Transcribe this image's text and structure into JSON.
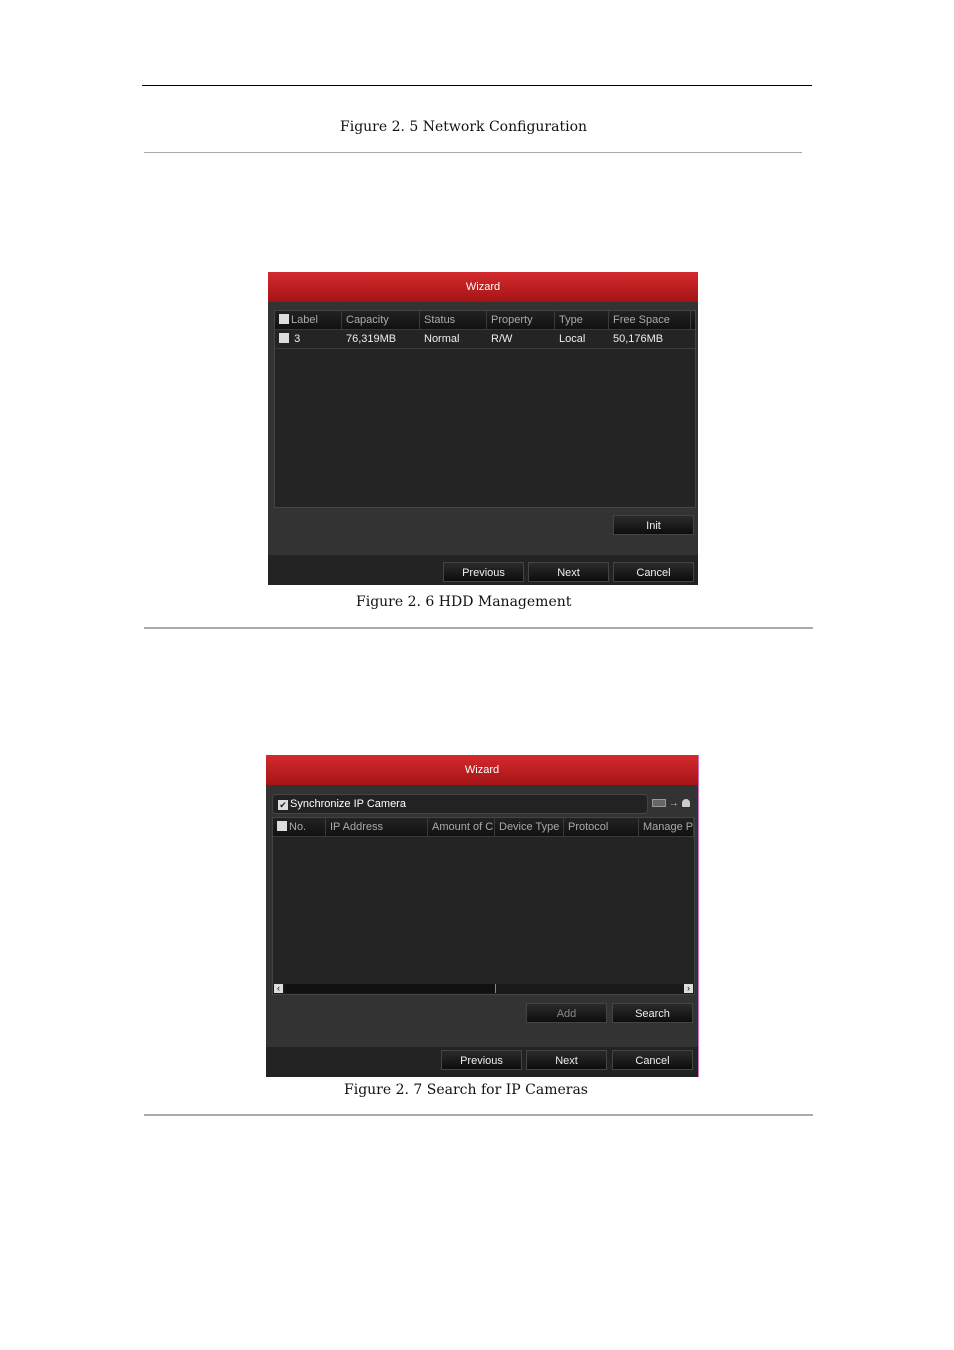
{
  "captions": {
    "fig25": "Figure 2. 5 Network Configuration",
    "fig26": "Figure 2. 6 HDD Management",
    "fig27": "Figure 2. 7 Search for IP Cameras"
  },
  "hdd_wizard": {
    "title": "Wizard",
    "columns": [
      "Label",
      "Capacity",
      "Status",
      "Property",
      "Type",
      "Free Space"
    ],
    "rows": [
      {
        "label": "3",
        "capacity": "76,319MB",
        "status": "Normal",
        "property": "R/W",
        "type": "Local",
        "free_space": "50,176MB"
      }
    ],
    "init_label": "Init",
    "previous_label": "Previous",
    "next_label": "Next",
    "cancel_label": "Cancel"
  },
  "ipcam_wizard": {
    "title": "Wizard",
    "sync_label": "Synchronize IP Camera",
    "sync_checked": true,
    "columns": [
      "No.",
      "IP Address",
      "Amount of C",
      "Device Type",
      "Protocol",
      "Manage P"
    ],
    "add_label": "Add",
    "search_label": "Search",
    "previous_label": "Previous",
    "next_label": "Next",
    "cancel_label": "Cancel"
  }
}
